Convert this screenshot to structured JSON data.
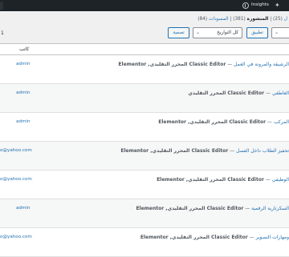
{
  "adminbar": {
    "insights_label": "Insights"
  },
  "views": {
    "published_label": "المنشورة",
    "published_count": "(381)",
    "drafts_label": "المسودات",
    "drafts_count": "(84)",
    "first_count": "(25)",
    "first_label_fragment": "ل",
    "separator": "|"
  },
  "tablenav": {
    "apply_button": "تطبيق",
    "dates_filter": "كل التواريخ",
    "filter_button": "تصفية",
    "page_indicator": "1"
  },
  "table": {
    "author_header": "كاتب",
    "rows": [
      {
        "title": "الرشيقة والمرونة في العمل",
        "separator": " — ",
        "states": "Classic Editor المحرر التقليدي, Elementor",
        "author": "admin"
      },
      {
        "title": "العاطفي",
        "separator": " — ",
        "states": "Classic Editor المحرر التقليدي",
        "author": "admin"
      },
      {
        "title": "المركب",
        "separator": " — ",
        "states": "Classic Editor المحرر التقليدي, Elementor",
        "author": "admin"
      },
      {
        "title": "تحفيز الطلاب داخل الفصل",
        "separator": " — ",
        "states": "Classic Editor المحرر التقليدي, Elementor",
        "author": "o@yahoo.com"
      },
      {
        "title": "الوظيفي",
        "separator": " — ",
        "states": "Classic Editor المحرر التقليدي, Elementor",
        "author": "o@yahoo.com"
      },
      {
        "title": "السكرتارية الرقمية",
        "separator": " — ",
        "states": "Classic Editor المحرر التقليدي, Elementor",
        "author": "admin"
      },
      {
        "title": "ومهارات التصوير",
        "separator": " — ",
        "states": "Classic Editor المحرر التقليدي, Elementor",
        "author": "o@yahoo.com"
      }
    ]
  }
}
